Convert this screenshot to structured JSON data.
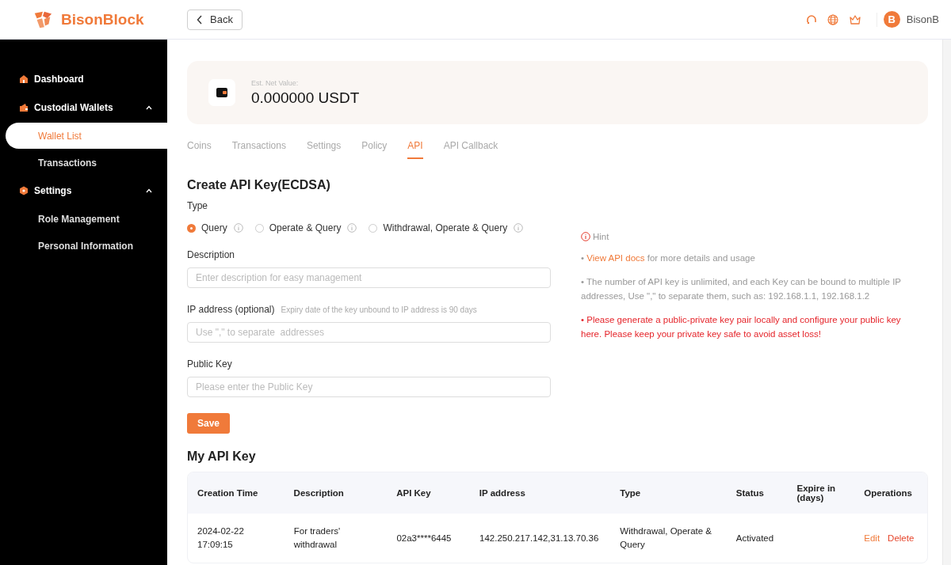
{
  "header": {
    "brand": "BisonBlock",
    "back": "Back",
    "avatar": "B",
    "user": "BisonB"
  },
  "sidebar": {
    "items": [
      {
        "label": "Dashboard",
        "selected": false
      },
      {
        "label": "Custodial Wallets",
        "expanded": true,
        "selected": false,
        "children": [
          {
            "label": "Wallet List",
            "selected": true
          },
          {
            "label": "Transactions",
            "selected": false
          }
        ]
      },
      {
        "label": "Settings",
        "expanded": true,
        "selected": false,
        "children": [
          {
            "label": "Role Management",
            "selected": false
          },
          {
            "label": "Personal Information",
            "selected": false
          }
        ]
      }
    ]
  },
  "wallet": {
    "net_value_label": "Est. Net Value:",
    "net_value": "0.000000 USDT"
  },
  "tabs": [
    {
      "label": "Coins",
      "selected": false
    },
    {
      "label": "Transactions",
      "selected": false
    },
    {
      "label": "Settings",
      "selected": false
    },
    {
      "label": "Policy",
      "selected": false
    },
    {
      "label": "API",
      "selected": true
    },
    {
      "label": "API Callback",
      "selected": false
    }
  ],
  "form": {
    "title": "Create API Key(ECDSA)",
    "type_label": "Type",
    "types": [
      {
        "label": "Query",
        "selected": true
      },
      {
        "label": "Operate & Query",
        "selected": false
      },
      {
        "label": "Withdrawal, Operate & Query",
        "selected": false
      }
    ],
    "description": {
      "label": "Description",
      "placeholder": "Enter description for easy management"
    },
    "ip": {
      "label": "IP address (optional)",
      "note": "Expiry date of the key unbound to IP address is 90 days",
      "placeholder": "Use \",\" to separate  addresses"
    },
    "public_key": {
      "label": "Public Key",
      "placeholder": "Please enter the Public Key"
    },
    "save": "Save"
  },
  "hint": {
    "title": "Hint",
    "items": [
      {
        "kind": "link",
        "bullet": "•",
        "link": "View API docs",
        "text": "for more details and usage"
      },
      {
        "kind": "note",
        "bullet": "•",
        "text": "The number of API key is unlimited, and each Key can be bound to multiple IP addresses, Use \",\" to separate them, such as: 192.168.1.1, 192.168.1.2"
      },
      {
        "kind": "warning",
        "bullet": "•",
        "text": "Please generate a public-private key pair locally and configure your public key here. Please keep your private key safe to avoid asset loss!"
      }
    ]
  },
  "table": {
    "title": "My API Key",
    "columns": [
      "Creation Time",
      "Description",
      "API Key",
      "IP address",
      "Type",
      "Status",
      "Expire in (days)",
      "Operations"
    ],
    "rows": [
      {
        "cells": [
          "2024-02-22 17:09:15",
          "For traders' withdrawal",
          "02a3****6445",
          "142.250.217.142,31.13.70.36",
          "Withdrawal, Operate & Query",
          "Activated",
          ""
        ],
        "operations": [
          "Edit",
          "Delete"
        ]
      }
    ]
  }
}
